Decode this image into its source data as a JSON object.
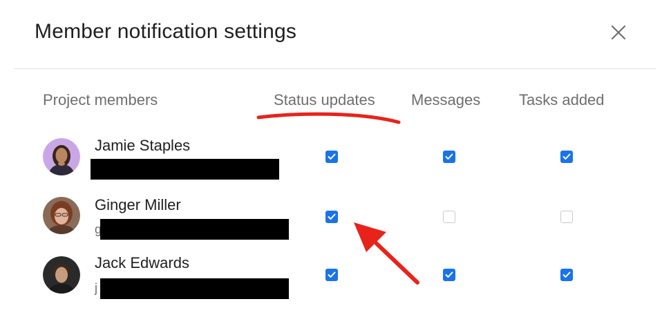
{
  "dialog": {
    "title": "Member notification settings",
    "close_icon": "close-icon"
  },
  "columns": {
    "members": "Project members",
    "status_updates": "Status updates",
    "messages": "Messages",
    "tasks_added": "Tasks added"
  },
  "members": [
    {
      "name": "Jamie Staples",
      "email_visible": "",
      "email_redacted": true,
      "status_updates": true,
      "messages": true,
      "tasks_added": true
    },
    {
      "name": "Ginger Miller",
      "email_visible": "g",
      "email_redacted": true,
      "status_updates": true,
      "messages": false,
      "tasks_added": false
    },
    {
      "name": "Jack Edwards",
      "email_visible": "j",
      "email_redacted": true,
      "status_updates": true,
      "messages": true,
      "tasks_added": true
    }
  ],
  "colors": {
    "checkbox_checked": "#1a73e8",
    "annotation_red": "#e8231c",
    "header_text": "#6d6e6f"
  }
}
